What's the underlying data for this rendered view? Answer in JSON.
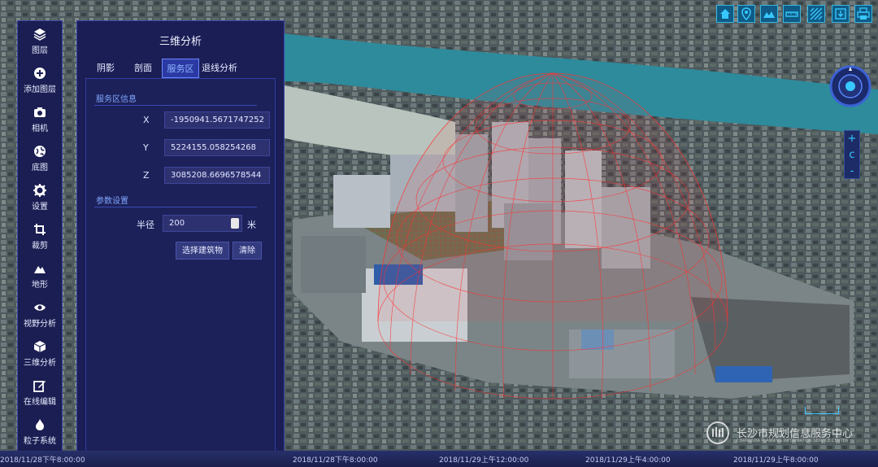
{
  "sidebar": {
    "items": [
      {
        "label": "图层",
        "icon": "layers-icon"
      },
      {
        "label": "添加图层",
        "icon": "plus-circle-icon"
      },
      {
        "label": "相机",
        "icon": "camera-icon"
      },
      {
        "label": "底图",
        "icon": "globe-icon"
      },
      {
        "label": "设置",
        "icon": "gear-icon"
      },
      {
        "label": "裁剪",
        "icon": "crop-icon"
      },
      {
        "label": "地形",
        "icon": "mountain-icon"
      },
      {
        "label": "视野分析",
        "icon": "eye-icon"
      },
      {
        "label": "三维分析",
        "icon": "cube-icon"
      },
      {
        "label": "在线编辑",
        "icon": "edit-icon"
      },
      {
        "label": "粒子系统",
        "icon": "fire-icon"
      }
    ]
  },
  "panel": {
    "title": "三维分析",
    "tabs": [
      "阴影",
      "剖面",
      "服务区",
      "退线分析"
    ],
    "active_tab": "服务区",
    "service_info_title": "服务区信息",
    "fields": [
      {
        "label": "X",
        "value": "-1950941.5671747252"
      },
      {
        "label": "Y",
        "value": "5224155.058254268"
      },
      {
        "label": "Z",
        "value": "3085208.6696578544"
      }
    ],
    "params_title": "参数设置",
    "radius_label": "半径",
    "radius_value": "200",
    "radius_unit": "米",
    "select_building_button": "选择建筑物",
    "clear_button": "清除"
  },
  "toolbar_right": {
    "icons": [
      "home-icon",
      "location-pin-icon",
      "landscape-icon",
      "ruler-icon",
      "hatch-area-icon",
      "export-icon",
      "print-icon"
    ]
  },
  "zoom": {
    "in": "+",
    "reset": "c",
    "out": "-"
  },
  "timeline": {
    "ticks": [
      "2018/11/28下午8:00:00",
      "2018/11/29上午12:00:00",
      "2018/11/29上午4:00:00",
      "2018/11/29上午8:00:00"
    ],
    "left_fragment": "2018/11/28下午8:00:00"
  },
  "watermark": {
    "title": "长沙市规划信息服务中心",
    "subtitle": "CHANGSHA PLANNING INFORMATION SERVICE CENTER"
  },
  "colors": {
    "panel_bg": "#1b1e55",
    "accent": "#37c8ff",
    "sphere_red": "#ff3030",
    "river": "#2d8b9c"
  }
}
